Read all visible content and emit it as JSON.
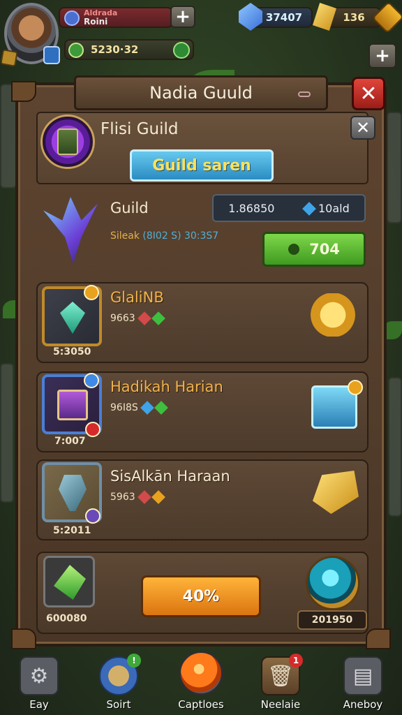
{
  "hud": {
    "player_line1": "Aldrada",
    "player_line2": "Roini",
    "xp_value": "5230·32",
    "gems": "37407",
    "gold": "136",
    "plus": "+"
  },
  "panel": {
    "title": "Nadia Guuld",
    "close": "✕",
    "guild_name": "Flisi Guild",
    "close_small": "✕",
    "search_button": "Guild saren",
    "guild_label": "Guild",
    "guild_stats_a": "Sileak",
    "guild_stats_b": "(8I02 S) 30:3S7",
    "stat_value": "1.86850",
    "stat_gem_label": "10ald",
    "green_button": "704"
  },
  "quests": [
    {
      "title": "GlaliNB",
      "sub": "9663",
      "level": "5:3050"
    },
    {
      "title": "Hadikah Harian",
      "sub": "96I8S",
      "level": "7:007"
    },
    {
      "title": "SisAlkān Haraan",
      "sub": "5963",
      "level": "5:2011"
    }
  ],
  "bottom": {
    "left_value": "600080",
    "progress_label": "40%",
    "progress": 0.4,
    "right_value": "201950"
  },
  "nav": [
    {
      "label": "Eay",
      "icon": "gear-icon"
    },
    {
      "label": "Soirt",
      "icon": "sword-icon"
    },
    {
      "label": "Captloes",
      "icon": "orb-icon"
    },
    {
      "label": "Neelaie",
      "icon": "trash-icon",
      "badge": "1"
    },
    {
      "label": "Aneboy",
      "icon": "inbox-icon"
    }
  ],
  "colors": {
    "accent_gold": "#f2b34a",
    "green_button": "#3f9a20",
    "orange_button": "#db7410",
    "close_red": "#c52c22",
    "search_blue": "#2a8cc2"
  }
}
